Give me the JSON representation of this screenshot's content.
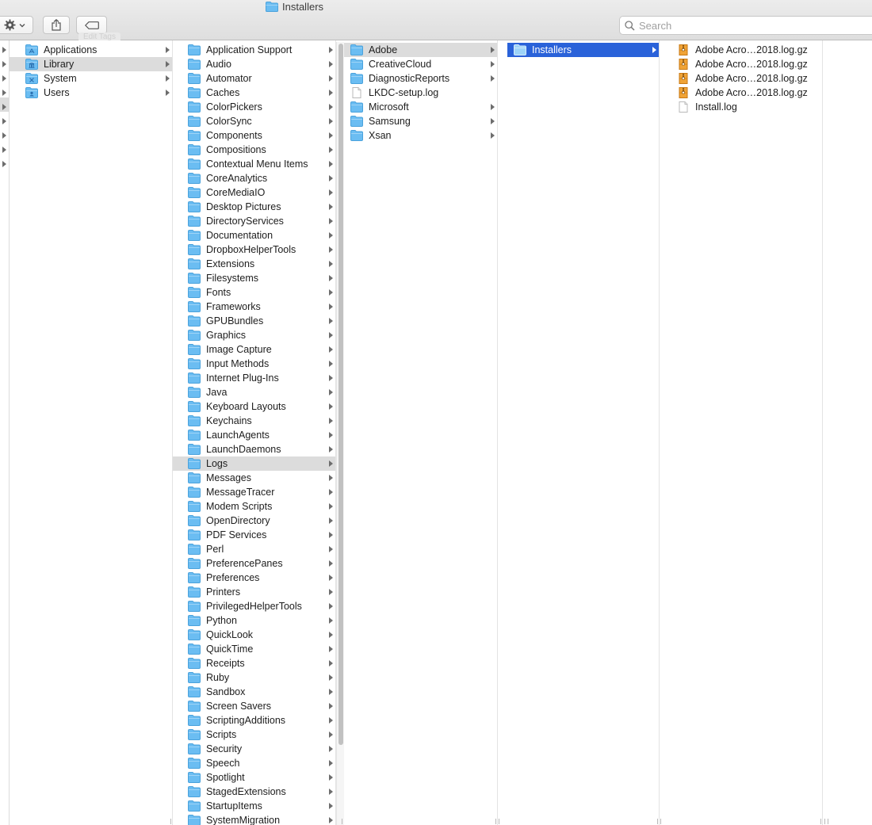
{
  "window": {
    "title": "Installers"
  },
  "toolbar": {
    "action_icon": "gear-icon",
    "share_icon": "share-icon",
    "tags_icon": "tag-icon",
    "ghost_tags_label": "Edit Tags",
    "search_placeholder": "Search"
  },
  "colors": {
    "selection_blue": "#2a62d9",
    "selection_gray": "#dcdcdc",
    "folder_blue": "#6bbdf2"
  },
  "columns": [
    {
      "id": "root",
      "items": [
        {
          "label": "Applications",
          "icon": "applications-folder-icon",
          "has_children": true
        },
        {
          "label": "Library",
          "icon": "library-folder-icon",
          "has_children": true,
          "selected": "gray"
        },
        {
          "label": "System",
          "icon": "system-folder-icon",
          "has_children": true
        },
        {
          "label": "Users",
          "icon": "users-folder-icon",
          "has_children": true
        }
      ]
    },
    {
      "id": "library",
      "items": [
        {
          "label": "Application Support",
          "icon": "folder-icon",
          "has_children": true
        },
        {
          "label": "Audio",
          "icon": "folder-icon",
          "has_children": true
        },
        {
          "label": "Automator",
          "icon": "folder-icon",
          "has_children": true
        },
        {
          "label": "Caches",
          "icon": "folder-icon",
          "has_children": true
        },
        {
          "label": "ColorPickers",
          "icon": "folder-icon",
          "has_children": true
        },
        {
          "label": "ColorSync",
          "icon": "folder-icon",
          "has_children": true
        },
        {
          "label": "Components",
          "icon": "folder-icon",
          "has_children": true
        },
        {
          "label": "Compositions",
          "icon": "folder-icon",
          "has_children": true
        },
        {
          "label": "Contextual Menu Items",
          "icon": "folder-icon",
          "has_children": true
        },
        {
          "label": "CoreAnalytics",
          "icon": "folder-icon",
          "has_children": true
        },
        {
          "label": "CoreMediaIO",
          "icon": "folder-icon",
          "has_children": true
        },
        {
          "label": "Desktop Pictures",
          "icon": "folder-icon",
          "has_children": true
        },
        {
          "label": "DirectoryServices",
          "icon": "folder-icon",
          "has_children": true
        },
        {
          "label": "Documentation",
          "icon": "folder-icon",
          "has_children": true
        },
        {
          "label": "DropboxHelperTools",
          "icon": "folder-icon",
          "has_children": true
        },
        {
          "label": "Extensions",
          "icon": "folder-icon",
          "has_children": true
        },
        {
          "label": "Filesystems",
          "icon": "folder-icon",
          "has_children": true
        },
        {
          "label": "Fonts",
          "icon": "folder-icon",
          "has_children": true
        },
        {
          "label": "Frameworks",
          "icon": "folder-icon",
          "has_children": true
        },
        {
          "label": "GPUBundles",
          "icon": "folder-icon",
          "has_children": true
        },
        {
          "label": "Graphics",
          "icon": "folder-icon",
          "has_children": true
        },
        {
          "label": "Image Capture",
          "icon": "folder-icon",
          "has_children": true
        },
        {
          "label": "Input Methods",
          "icon": "folder-icon",
          "has_children": true
        },
        {
          "label": "Internet Plug-Ins",
          "icon": "folder-icon",
          "has_children": true
        },
        {
          "label": "Java",
          "icon": "folder-icon",
          "has_children": true
        },
        {
          "label": "Keyboard Layouts",
          "icon": "folder-icon",
          "has_children": true
        },
        {
          "label": "Keychains",
          "icon": "folder-icon",
          "has_children": true
        },
        {
          "label": "LaunchAgents",
          "icon": "folder-icon",
          "has_children": true
        },
        {
          "label": "LaunchDaemons",
          "icon": "folder-icon",
          "has_children": true
        },
        {
          "label": "Logs",
          "icon": "folder-icon",
          "has_children": true,
          "selected": "gray"
        },
        {
          "label": "Messages",
          "icon": "folder-icon",
          "has_children": true
        },
        {
          "label": "MessageTracer",
          "icon": "folder-icon",
          "has_children": true
        },
        {
          "label": "Modem Scripts",
          "icon": "folder-icon",
          "has_children": true
        },
        {
          "label": "OpenDirectory",
          "icon": "folder-icon",
          "has_children": true
        },
        {
          "label": "PDF Services",
          "icon": "folder-icon",
          "has_children": true
        },
        {
          "label": "Perl",
          "icon": "folder-icon",
          "has_children": true
        },
        {
          "label": "PreferencePanes",
          "icon": "folder-icon",
          "has_children": true
        },
        {
          "label": "Preferences",
          "icon": "folder-icon",
          "has_children": true
        },
        {
          "label": "Printers",
          "icon": "folder-icon",
          "has_children": true
        },
        {
          "label": "PrivilegedHelperTools",
          "icon": "folder-icon",
          "has_children": true
        },
        {
          "label": "Python",
          "icon": "folder-icon",
          "has_children": true
        },
        {
          "label": "QuickLook",
          "icon": "folder-icon",
          "has_children": true
        },
        {
          "label": "QuickTime",
          "icon": "folder-icon",
          "has_children": true
        },
        {
          "label": "Receipts",
          "icon": "folder-icon",
          "has_children": true
        },
        {
          "label": "Ruby",
          "icon": "folder-icon",
          "has_children": true
        },
        {
          "label": "Sandbox",
          "icon": "folder-icon",
          "has_children": true
        },
        {
          "label": "Screen Savers",
          "icon": "folder-icon",
          "has_children": true
        },
        {
          "label": "ScriptingAdditions",
          "icon": "folder-icon",
          "has_children": true
        },
        {
          "label": "Scripts",
          "icon": "folder-icon",
          "has_children": true
        },
        {
          "label": "Security",
          "icon": "folder-icon",
          "has_children": true
        },
        {
          "label": "Speech",
          "icon": "folder-icon",
          "has_children": true
        },
        {
          "label": "Spotlight",
          "icon": "folder-icon",
          "has_children": true
        },
        {
          "label": "StagedExtensions",
          "icon": "folder-icon",
          "has_children": true
        },
        {
          "label": "StartupItems",
          "icon": "folder-icon",
          "has_children": true
        },
        {
          "label": "SystemMigration",
          "icon": "folder-icon",
          "has_children": true
        }
      ]
    },
    {
      "id": "logs",
      "items": [
        {
          "label": "Adobe",
          "icon": "folder-icon",
          "has_children": true,
          "selected": "gray"
        },
        {
          "label": "CreativeCloud",
          "icon": "folder-icon",
          "has_children": true
        },
        {
          "label": "DiagnosticReports",
          "icon": "folder-icon",
          "has_children": true
        },
        {
          "label": "LKDC-setup.log",
          "icon": "document-icon",
          "has_children": false
        },
        {
          "label": "Microsoft",
          "icon": "folder-icon",
          "has_children": true
        },
        {
          "label": "Samsung",
          "icon": "folder-icon",
          "has_children": true
        },
        {
          "label": "Xsan",
          "icon": "folder-icon",
          "has_children": true
        }
      ]
    },
    {
      "id": "adobe",
      "items": [
        {
          "label": "Installers",
          "icon": "folder-icon",
          "has_children": true,
          "selected": "blue"
        }
      ]
    },
    {
      "id": "installers",
      "items": [
        {
          "label": "Adobe Acro…2018.log.gz",
          "icon": "archive-icon",
          "has_children": false
        },
        {
          "label": "Adobe Acro…2018.log.gz",
          "icon": "archive-icon",
          "has_children": false
        },
        {
          "label": "Adobe Acro…2018.log.gz",
          "icon": "archive-icon",
          "has_children": false
        },
        {
          "label": "Adobe Acro…2018.log.gz",
          "icon": "archive-icon",
          "has_children": false
        },
        {
          "label": "Install.log",
          "icon": "document-icon",
          "has_children": false
        }
      ]
    }
  ]
}
